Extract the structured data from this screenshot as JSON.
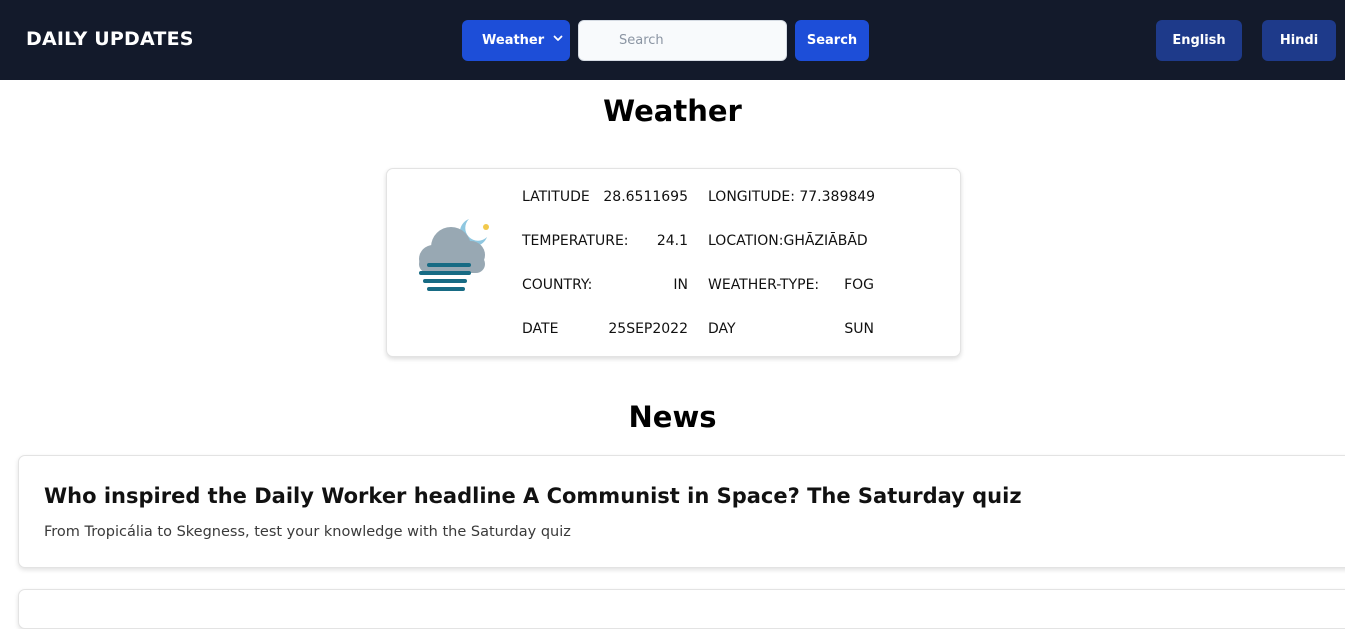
{
  "header": {
    "brand": "DAILY UPDATES",
    "category_select": {
      "selected": "Weather",
      "icon": "chevron-down-icon"
    },
    "search": {
      "placeholder": "Search",
      "value": ""
    },
    "search_button": "Search",
    "language_buttons": [
      "English",
      "Hindi"
    ]
  },
  "weather": {
    "title": "Weather",
    "icon": "fog-night-icon",
    "rows": [
      {
        "l1": "LATITUDE",
        "v1": "28.6511695",
        "l2": "LONGITUDE: 77.389849",
        "v2": ""
      },
      {
        "l1": "TEMPERATURE:",
        "v1": "24.1",
        "l2": "LOCATION:GHĀZIĀBĀD",
        "v2": ""
      },
      {
        "l1": "COUNTRY:",
        "v1": "IN",
        "l2": "WEATHER-TYPE:",
        "v2": "FOG"
      },
      {
        "l1": "DATE",
        "v1": "25SEP2022",
        "l2": "DAY",
        "v2": "SUN"
      }
    ]
  },
  "news": {
    "title": "News",
    "items": [
      {
        "title": "Who inspired the Daily Worker headline A Communist in Space? The Saturday quiz",
        "description": "From Tropicália to Skegness, test your knowledge with the Saturday quiz"
      }
    ]
  },
  "colors": {
    "topbar": "#131a2b",
    "primary_button": "#1d4ed8",
    "language_button": "#1e3a8a"
  }
}
